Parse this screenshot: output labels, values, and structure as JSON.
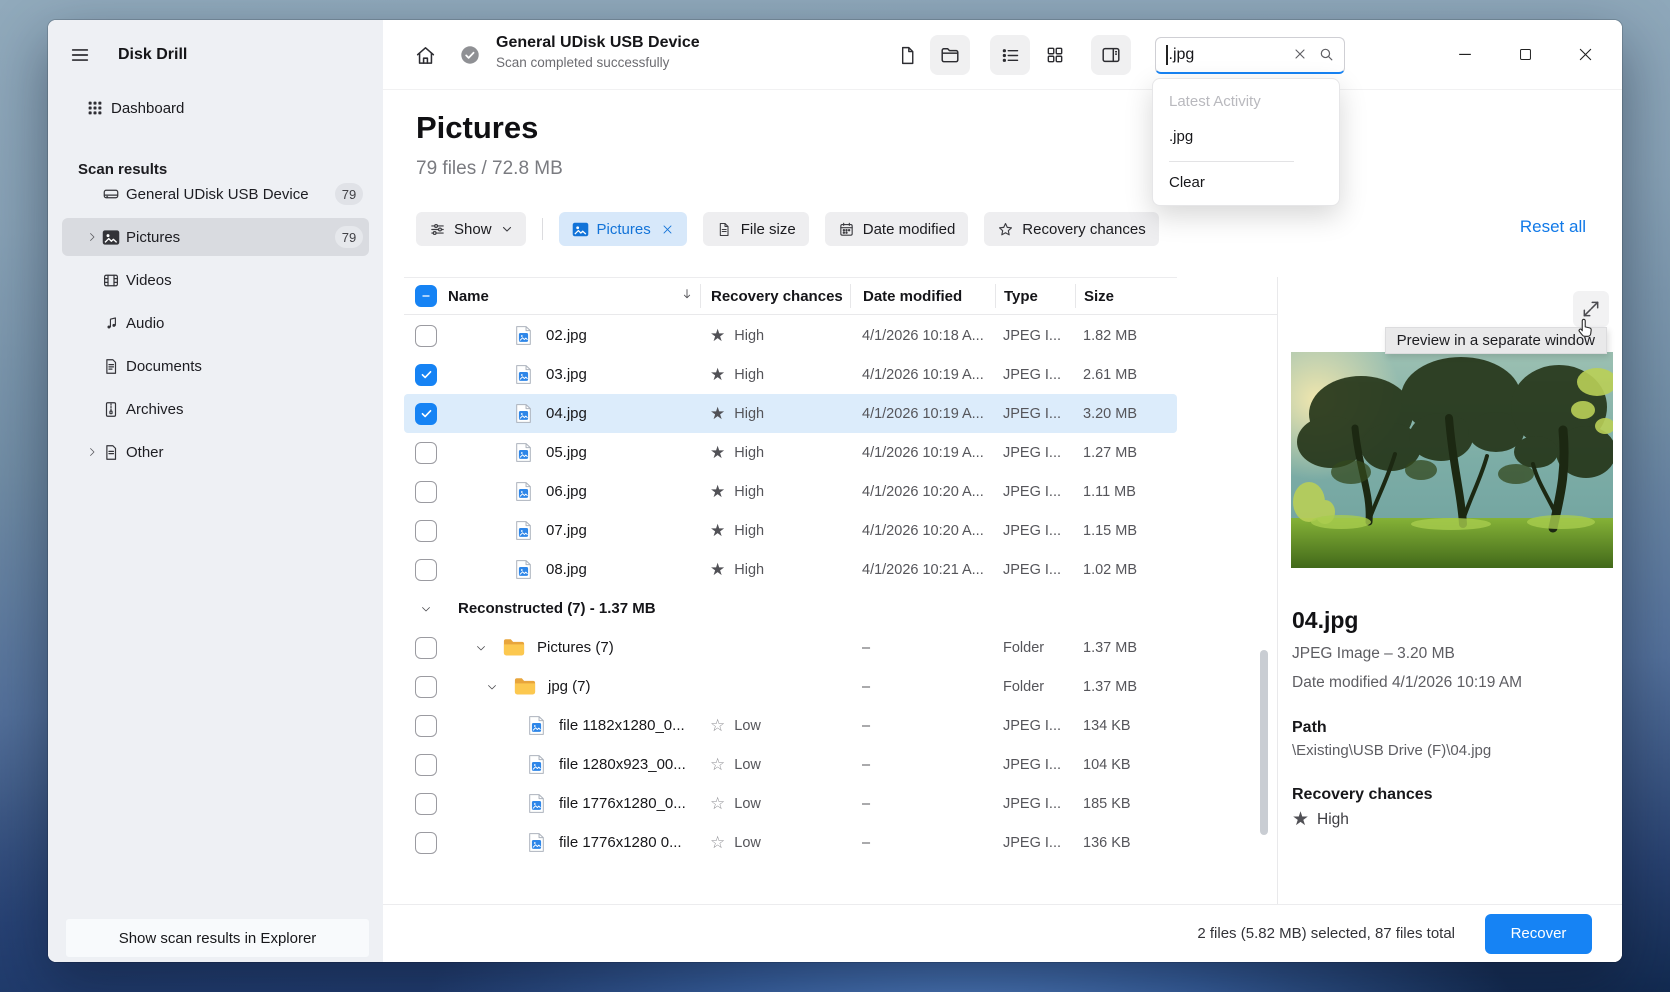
{
  "colors": {
    "accent": "#1683f4",
    "selected_row": "#dcecfb",
    "link": "#1079e8"
  },
  "sidebar": {
    "app_title": "Disk Drill",
    "dashboard_label": "Dashboard",
    "section_label": "Scan results",
    "items": [
      {
        "id": "device",
        "icon": "drive",
        "label": "General UDisk USB Device",
        "badge": "79"
      },
      {
        "id": "pictures",
        "icon": "image",
        "label": "Pictures",
        "badge": "79",
        "chevron": true,
        "selected": true
      },
      {
        "id": "videos",
        "icon": "film",
        "label": "Videos"
      },
      {
        "id": "audio",
        "icon": "note",
        "label": "Audio"
      },
      {
        "id": "documents",
        "icon": "doc",
        "label": "Documents"
      },
      {
        "id": "archives",
        "icon": "zip",
        "label": "Archives"
      },
      {
        "id": "other",
        "icon": "file",
        "label": "Other",
        "chevron": true
      }
    ],
    "explorer_button_label": "Show scan results in Explorer"
  },
  "topbar": {
    "device_title": "General UDisk USB Device",
    "device_status": "Scan completed successfully",
    "search_value": ".jpg",
    "search_dropdown": {
      "header": "Latest Activity",
      "recent_item": ".jpg",
      "clear_label": "Clear"
    }
  },
  "page": {
    "title": "Pictures",
    "summary": "79 files / 72.8 MB"
  },
  "filters": {
    "show_label": "Show",
    "chips": [
      {
        "icon": "image",
        "label": "Pictures",
        "active": true,
        "removable": true
      },
      {
        "icon": "page",
        "label": "File size"
      },
      {
        "icon": "calendar",
        "label": "Date modified"
      },
      {
        "icon": "star",
        "label": "Recovery chances"
      }
    ],
    "reset_label": "Reset all"
  },
  "table": {
    "columns": [
      "Name",
      "Recovery chances",
      "Date modified",
      "Type",
      "Size"
    ],
    "rows": [
      {
        "kind": "file",
        "level": 1,
        "name": "02.jpg",
        "checked": false,
        "star": "filled",
        "recovery": "High",
        "date": "4/1/2026 10:18 A...",
        "type": "JPEG I...",
        "size": "1.82 MB"
      },
      {
        "kind": "file",
        "level": 1,
        "name": "03.jpg",
        "checked": true,
        "star": "filled",
        "recovery": "High",
        "date": "4/1/2026 10:19 A...",
        "type": "JPEG I...",
        "size": "2.61 MB"
      },
      {
        "kind": "file",
        "level": 1,
        "name": "04.jpg",
        "checked": true,
        "selected": true,
        "star": "filled",
        "recovery": "High",
        "date": "4/1/2026 10:19 A...",
        "type": "JPEG I...",
        "size": "3.20 MB"
      },
      {
        "kind": "file",
        "level": 1,
        "name": "05.jpg",
        "checked": false,
        "star": "filled",
        "recovery": "High",
        "date": "4/1/2026 10:19 A...",
        "type": "JPEG I...",
        "size": "1.27 MB"
      },
      {
        "kind": "file",
        "level": 1,
        "name": "06.jpg",
        "checked": false,
        "star": "filled",
        "recovery": "High",
        "date": "4/1/2026 10:20 A...",
        "type": "JPEG I...",
        "size": "1.11 MB"
      },
      {
        "kind": "file",
        "level": 1,
        "name": "07.jpg",
        "checked": false,
        "star": "filled",
        "recovery": "High",
        "date": "4/1/2026 10:20 A...",
        "type": "JPEG I...",
        "size": "1.15 MB"
      },
      {
        "kind": "file",
        "level": 1,
        "name": "08.jpg",
        "checked": false,
        "star": "filled",
        "recovery": "High",
        "date": "4/1/2026 10:21 A...",
        "type": "JPEG I...",
        "size": "1.02 MB"
      },
      {
        "kind": "group",
        "name": "Reconstructed (7) - 1.37 MB",
        "expanded": true
      },
      {
        "kind": "folder",
        "level": 1,
        "name": "Pictures (7)",
        "checked": false,
        "expanded": true,
        "date": "–",
        "type": "Folder",
        "size": "1.37 MB"
      },
      {
        "kind": "folder",
        "level": 2,
        "name": "jpg (7)",
        "checked": false,
        "expanded": true,
        "date": "–",
        "type": "Folder",
        "size": "1.37 MB"
      },
      {
        "kind": "file",
        "level": 2,
        "name": "file 1182x1280_0...",
        "checked": false,
        "star": "outline",
        "recovery": "Low",
        "date": "–",
        "type": "JPEG I...",
        "size": "134 KB"
      },
      {
        "kind": "file",
        "level": 2,
        "name": "file 1280x923_00...",
        "checked": false,
        "star": "outline",
        "recovery": "Low",
        "date": "–",
        "type": "JPEG I...",
        "size": "104 KB"
      },
      {
        "kind": "file",
        "level": 2,
        "name": "file 1776x1280_0...",
        "checked": false,
        "star": "outline",
        "recovery": "Low",
        "date": "–",
        "type": "JPEG I...",
        "size": "185 KB"
      },
      {
        "kind": "file",
        "level": 2,
        "name": "file 1776x1280 0...",
        "checked": false,
        "star": "outline",
        "recovery": "Low",
        "date": "–",
        "type": "JPEG I...",
        "size": "136 KB"
      }
    ]
  },
  "preview": {
    "tooltip": "Preview in a separate window",
    "filename": "04.jpg",
    "meta_line1": "JPEG Image – 3.20 MB",
    "meta_line2": "Date modified 4/1/2026 10:19 AM",
    "path_label": "Path",
    "path_value": "\\Existing\\USB Drive (F)\\04.jpg",
    "recovery_label": "Recovery chances",
    "recovery_value": "High"
  },
  "footer": {
    "selection_status": "2 files (5.82 MB) selected, 87 files total",
    "recover_label": "Recover"
  }
}
